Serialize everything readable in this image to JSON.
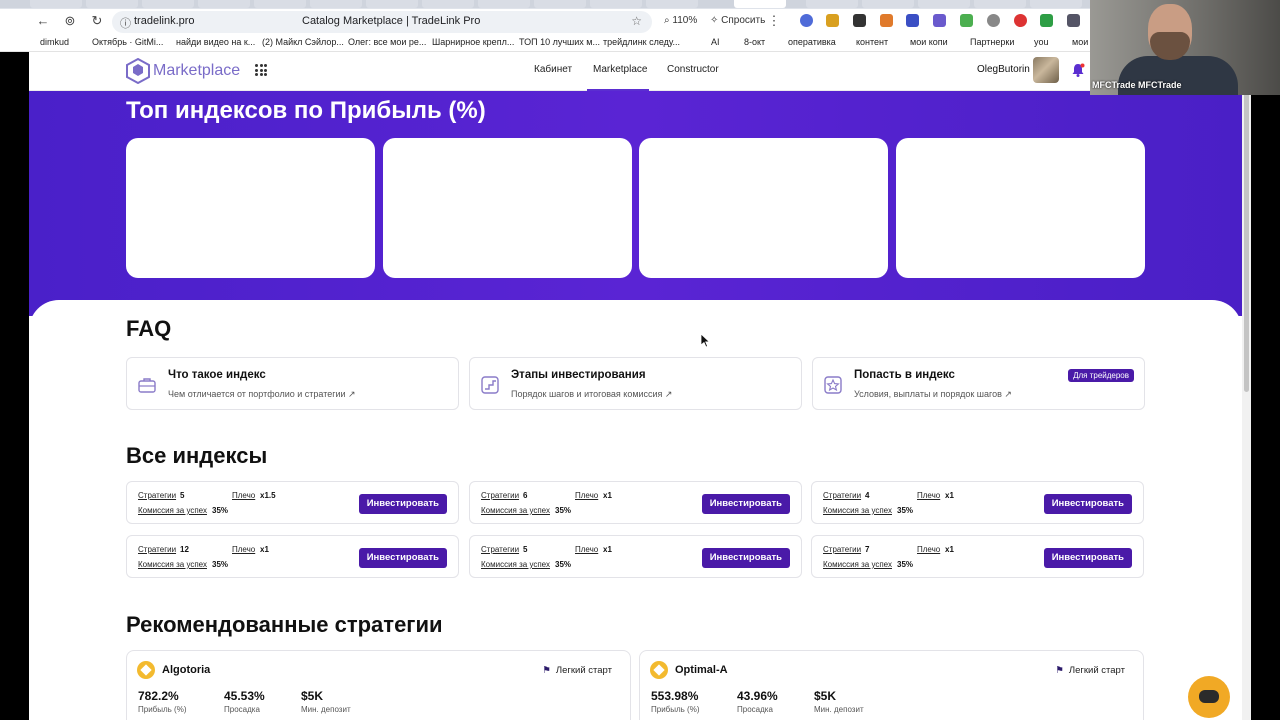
{
  "browser": {
    "url": "tradelink.pro",
    "page_title": "Catalog Marketplace | TradeLink Pro",
    "zoom": "110%",
    "ask_label": "Спросить",
    "bookmarks": [
      "dimkud",
      "Октябрь · GitMi...",
      "найди видео на к...",
      "(2) Майкл Сэйлор...",
      "Олег: все мои ре...",
      "Шарнирное крепл...",
      "ТОП 10 лучших м...",
      "трейдлинк следу...",
      "AI",
      "8-окт",
      "оперативка",
      "контент",
      "мои копи",
      "Партнерки",
      "you",
      "мои"
    ]
  },
  "header": {
    "logo_text": "Marketplace",
    "nav": [
      "Кабинет",
      "Marketplace",
      "Constructor"
    ],
    "active_nav": "Marketplace",
    "username": "OlegButorin"
  },
  "hero": {
    "title": "Топ индексов по Прибыль (%)"
  },
  "faq": {
    "title": "FAQ",
    "items": [
      {
        "title": "Что такое индекс",
        "subtitle": "Чем отличается от портфолио и стратегии ↗",
        "badge": ""
      },
      {
        "title": "Этапы инвестирования",
        "subtitle": "Порядок шагов и итоговая комиссия ↗",
        "badge": ""
      },
      {
        "title": "Попасть в индекс",
        "subtitle": "Условия, выплаты и порядок шагов ↗",
        "badge": "Для трейдеров"
      }
    ]
  },
  "indexes": {
    "title": "Все индексы",
    "labels": {
      "strategies": "Стратегии",
      "leverage": "Плечо",
      "commission": "Комиссия за успех"
    },
    "button": "Инвестировать",
    "items": [
      {
        "strategies": "5",
        "leverage": "x1.5",
        "commission": "35%"
      },
      {
        "strategies": "6",
        "leverage": "x1",
        "commission": "35%"
      },
      {
        "strategies": "4",
        "leverage": "x1",
        "commission": "35%"
      },
      {
        "strategies": "12",
        "leverage": "x1",
        "commission": "35%"
      },
      {
        "strategies": "5",
        "leverage": "x1",
        "commission": "35%"
      },
      {
        "strategies": "7",
        "leverage": "x1",
        "commission": "35%"
      }
    ]
  },
  "recommended": {
    "title": "Рекомендованные стратегии",
    "metric_labels": {
      "profit": "Прибыль (%)",
      "drawdown": "Просадка",
      "min_deposit": "Мин. депозит"
    },
    "items": [
      {
        "name": "Algotoria",
        "tag": "Легкий старт",
        "profit": "782.2%",
        "drawdown": "45.53%",
        "min_deposit": "$5K"
      },
      {
        "name": "Optimal-A",
        "tag": "Легкий старт",
        "profit": "553.98%",
        "drawdown": "43.96%",
        "min_deposit": "$5K"
      }
    ]
  },
  "webcam": {
    "caption": "MFCTrade MFCTrade"
  },
  "colors": {
    "brand_purple": "#4a1aa8",
    "hero_purple": "#5a24d4",
    "chat_orange": "#f1a925"
  }
}
